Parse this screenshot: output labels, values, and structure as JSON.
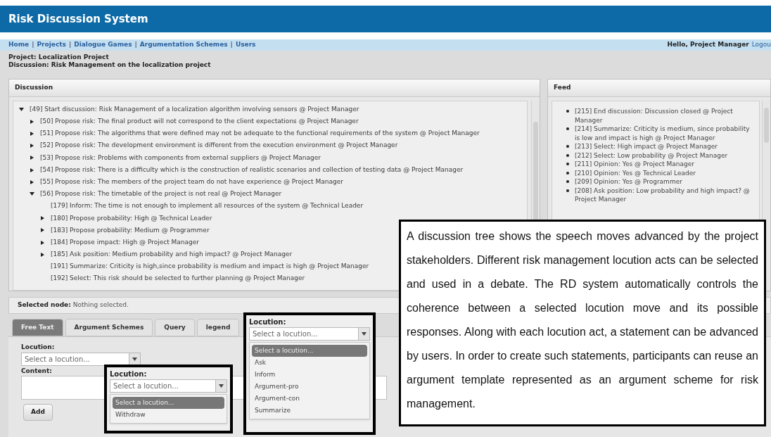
{
  "header": {
    "title": "Risk Discussion System"
  },
  "nav": {
    "separator": "|",
    "links": [
      "Home",
      "Projects",
      "Dialogue Games",
      "Argumentation Schemes",
      "Users"
    ],
    "greeting": "Hello, Project Manager",
    "logout": "Logou"
  },
  "info_lines": [
    "Project: Localization Project",
    "Discussion: Risk Management on the localization project"
  ],
  "discussion": {
    "title": "Discussion",
    "tree": [
      {
        "text": "[49] Start discussion: Risk Management of a localization algorithm involving sensors @ Project Manager",
        "kind": "branch",
        "expanded": true,
        "children": [
          {
            "text": "[50] Propose risk: The final product will not correspond to the client expectations @ Project Manager",
            "kind": "branch",
            "expanded": false
          },
          {
            "text": "[51] Propose risk: The algorithms that were defined may not be adequate to the functional requirements of the system @ Project Manager",
            "kind": "branch",
            "expanded": false
          },
          {
            "text": "[52] Propose risk: The development environment is different from the execution environment @ Project Manager",
            "kind": "branch",
            "expanded": false
          },
          {
            "text": "[53] Propose risk: Problems with components from external suppliers @ Project Manager",
            "kind": "branch",
            "expanded": false
          },
          {
            "text": "[54] Propose risk: There is a difficulty which is the construction of realistic scenarios and collection of testing data @ Project Manager",
            "kind": "branch",
            "expanded": false
          },
          {
            "text": "[55] Propose risk: The members of the project team do not have experience @ Project Manager",
            "kind": "branch",
            "expanded": false
          },
          {
            "text": "[56] Propose risk: The timetable of the project is not real @ Project Manager",
            "kind": "branch",
            "expanded": true,
            "children": [
              {
                "text": "[179] Inform: The time is not enough to implement all resources of the system @ Technical Leader",
                "kind": "leaf"
              },
              {
                "text": "[180] Propose probability: High @ Technical Leader",
                "kind": "branch",
                "expanded": false
              },
              {
                "text": "[183] Propose probability: Medium @ Programmer",
                "kind": "branch",
                "expanded": false
              },
              {
                "text": "[184] Propose impact: High @ Project Manager",
                "kind": "branch",
                "expanded": false
              },
              {
                "text": "[185] Ask position: Medium probability and high impact? @ Project Manager",
                "kind": "branch",
                "expanded": false
              },
              {
                "text": "[191] Summarize: Criticity is high,since probability is medium and impact is high @ Project Manager",
                "kind": "leaf"
              },
              {
                "text": "[192] Select: This risk should be selected to further planning @ Project Manager",
                "kind": "leaf"
              }
            ]
          }
        ]
      }
    ]
  },
  "feed": {
    "title": "Feed",
    "items": [
      "[215] End discussion: Discussion closed @ Project Manager",
      "[214] Summarize: Criticity is medium, since probability is low and impact is high @ Project Manager",
      "[213] Select: High impact @ Project Manager",
      "[212] Select: Low probability @ Project Manager",
      "[211] Opinion: Yes @ Project Manager",
      "[210] Opinion: Yes @ Technical Leader",
      "[209] Opinion: Yes @ Programmer",
      "[208] Ask position: Low probability and high impact? @ Project Manager"
    ]
  },
  "selected_node": {
    "label": "Selected node:",
    "value": "Nothing selected."
  },
  "tabs": [
    {
      "label": "Free Text",
      "selected": true
    },
    {
      "label": "Argument Schemes",
      "selected": false
    },
    {
      "label": "Query",
      "selected": false
    },
    {
      "label": "legend",
      "selected": false
    }
  ],
  "form": {
    "locution_label": "Locution:",
    "locution_value": "Select a locution...",
    "content_label": "Content:",
    "add_button": "Add"
  },
  "dropdown_callouts": [
    {
      "label": "Locution:",
      "value": "Select a locution...",
      "options": [
        {
          "label": "Select a locution...",
          "selected": true
        },
        {
          "label": "Withdraw",
          "selected": false
        }
      ]
    },
    {
      "label": "Locution:",
      "value": "Select a locution...",
      "options": [
        {
          "label": "Select a locution...",
          "selected": true
        },
        {
          "label": "Ask",
          "selected": false
        },
        {
          "label": "Inform",
          "selected": false
        },
        {
          "label": "Argument-pro",
          "selected": false
        },
        {
          "label": "Argument-con",
          "selected": false
        },
        {
          "label": "Summarize",
          "selected": false
        }
      ]
    }
  ],
  "note": {
    "text": "A discussion tree shows the speech moves advanced by the project stakeholders. Different risk management locution acts can be selected and used in a debate. The RD system automatically controls the coherence between a selected locution move and its possible responses. Along with each locution act, a statement can be advanced by users. In order to create such statements, participants can reuse an argument template represented as an argument scheme for risk management."
  }
}
